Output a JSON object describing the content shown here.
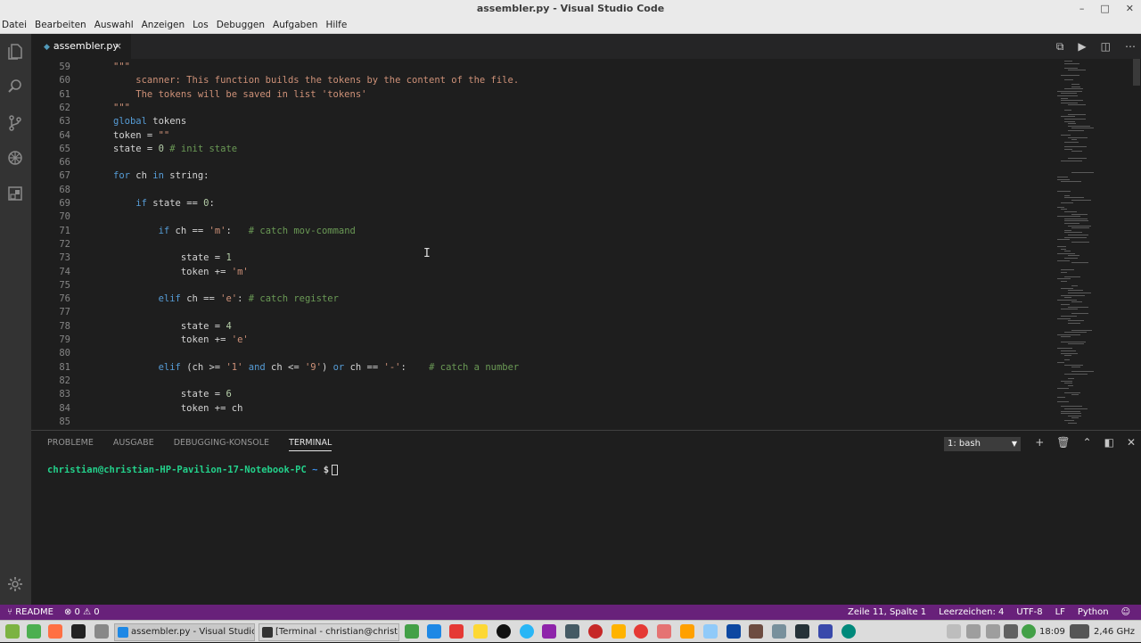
{
  "window": {
    "title": "assembler.py - Visual Studio Code"
  },
  "menu": [
    "Datei",
    "Bearbeiten",
    "Auswahl",
    "Anzeigen",
    "Los",
    "Debuggen",
    "Aufgaben",
    "Hilfe"
  ],
  "tab": {
    "label": "assembler.py",
    "close": "×"
  },
  "editor": {
    "line_numbers": [
      "59",
      "60",
      "61",
      "62",
      "63",
      "64",
      "65",
      "66",
      "67",
      "68",
      "69",
      "70",
      "71",
      "72",
      "73",
      "74",
      "75",
      "76",
      "77",
      "78",
      "79",
      "80",
      "81",
      "82",
      "83",
      "84",
      "85"
    ]
  },
  "panel": {
    "tabs": [
      "PROBLEME",
      "AUSGABE",
      "DEBUGGING-KONSOLE",
      "TERMINAL"
    ],
    "active_tab": "TERMINAL",
    "terminal_select": "1: bash",
    "prompt_user": "christian@christian-HP-Pavilion-17-Notebook-PC",
    "prompt_path": "~",
    "prompt_symbol": "$"
  },
  "status": {
    "branch": "README",
    "errors": "0",
    "warnings": "0",
    "position": "Zeile 11, Spalte 1",
    "indent": "Leerzeichen: 4",
    "encoding": "UTF-8",
    "eol": "LF",
    "language": "Python"
  },
  "taskbar": {
    "window1": "assembler.py - Visual Studio ...",
    "window2": "[Terminal - christian@christi...",
    "time": "18:09",
    "cpu": "2,46 GHz"
  },
  "colors": {
    "statusbar": "#68217a",
    "activity": "#333333",
    "editor_bg": "#1e1e1e"
  }
}
